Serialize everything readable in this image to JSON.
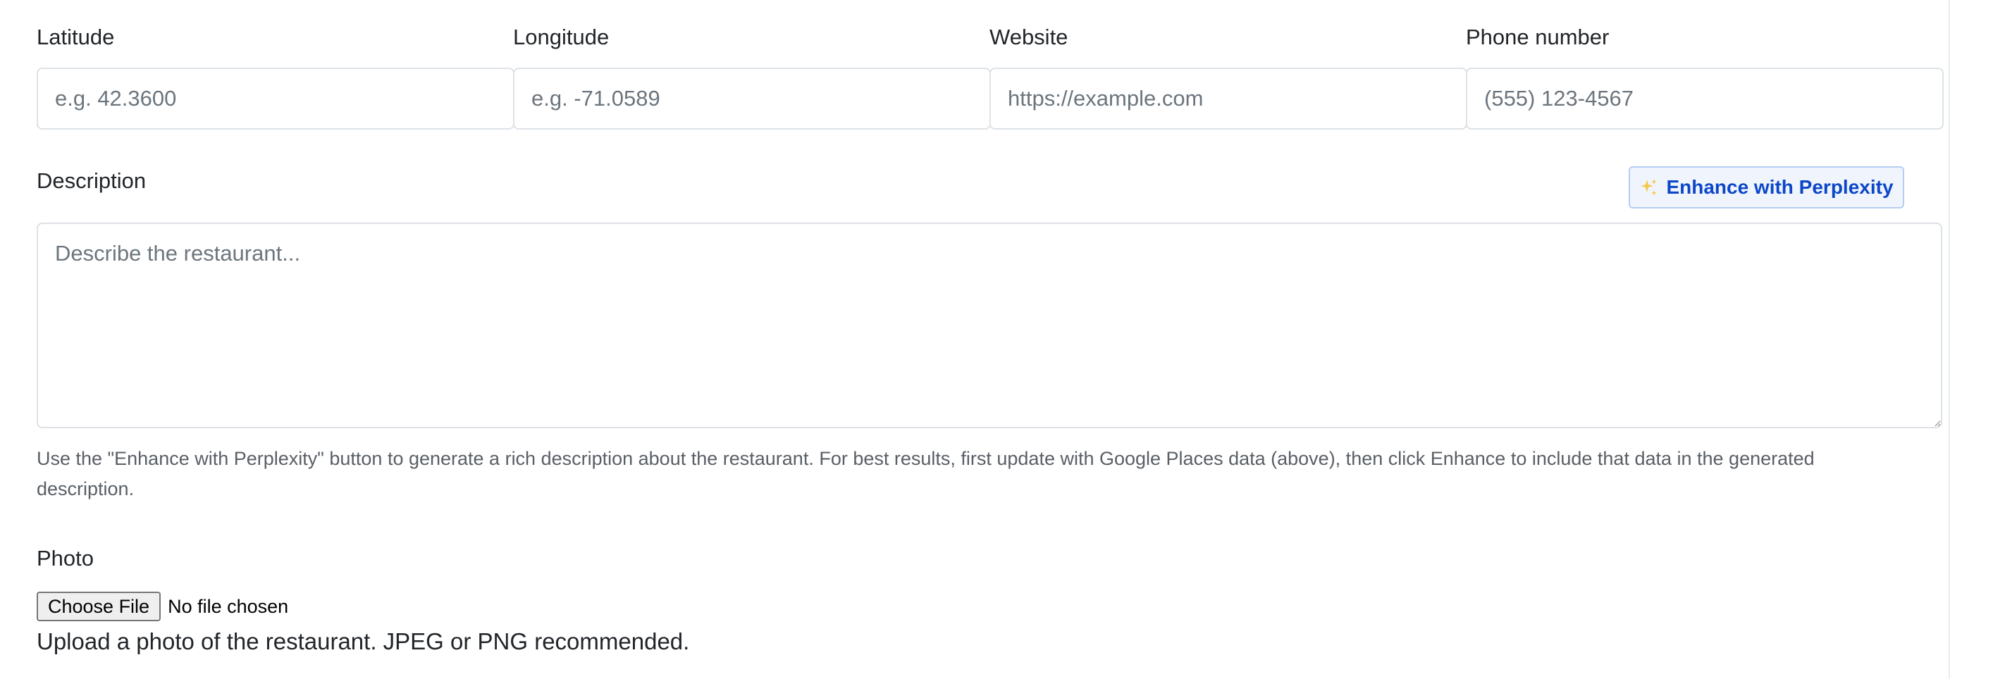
{
  "fields": {
    "latitude": {
      "label": "Latitude",
      "placeholder": "e.g. 42.3600"
    },
    "longitude": {
      "label": "Longitude",
      "placeholder": "e.g. -71.0589"
    },
    "website": {
      "label": "Website",
      "placeholder": "https://example.com"
    },
    "phone": {
      "label": "Phone number",
      "placeholder": "(555) 123-4567"
    }
  },
  "description": {
    "label": "Description",
    "placeholder": "Describe the restaurant...",
    "enhance_button": "Enhance with Perplexity",
    "enhance_icon": "sparkles-icon",
    "help_text": "Use the \"Enhance with Perplexity\" button to generate a rich description about the restaurant. For best results, first update with Google Places data (above), then click Enhance to include that data in the generated description."
  },
  "photo": {
    "label": "Photo",
    "choose_button": "Choose File",
    "file_status": "No file chosen",
    "help_text": "Upload a photo of the restaurant. JPEG or PNG recommended."
  },
  "colors": {
    "accent": "#0d47c8",
    "sparkle": "#f2c94c",
    "border": "#dee2e6"
  }
}
